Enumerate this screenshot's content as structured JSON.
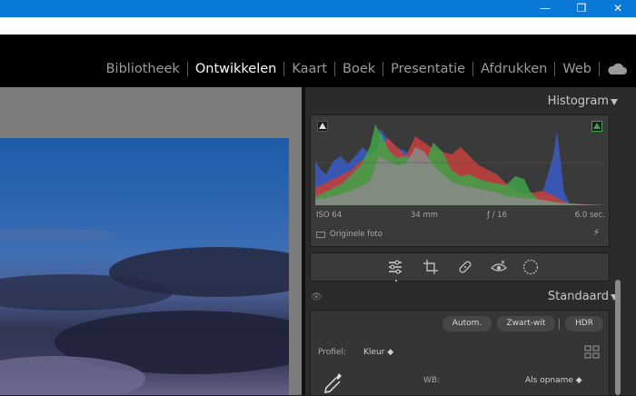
{
  "window": {
    "controls": {
      "minimize": "—",
      "maximize": "❐",
      "close": "✕"
    }
  },
  "modules": [
    {
      "label": "Bibliotheek",
      "active": false
    },
    {
      "label": "Ontwikkelen",
      "active": true
    },
    {
      "label": "Kaart",
      "active": false
    },
    {
      "label": "Boek",
      "active": false
    },
    {
      "label": "Presentatie",
      "active": false
    },
    {
      "label": "Afdrukken",
      "active": false
    },
    {
      "label": "Web",
      "active": false
    }
  ],
  "histogram": {
    "title": "Histogram",
    "iso": "ISO 64",
    "focal": "34 mm",
    "aperture": "ƒ / 16",
    "shutter": "6.0 sec.",
    "original_photo": "Originele foto",
    "colors": {
      "red": "#c0403c",
      "green": "#3fa34a",
      "blue": "#3957b8",
      "yellow": "#b3a13a"
    }
  },
  "tools": [
    "sliders-icon",
    "crop-icon",
    "healing-icon",
    "redeye-icon",
    "mask-icon"
  ],
  "basic": {
    "title": "Standaard",
    "auto_label": "Autom.",
    "bw_label": "Zwart-wit",
    "hdr_label": "HDR",
    "profile_label": "Profiel:",
    "profile_value": "Kleur ◆",
    "wb_label": "WB:",
    "wb_value": "Als opname ◆"
  }
}
